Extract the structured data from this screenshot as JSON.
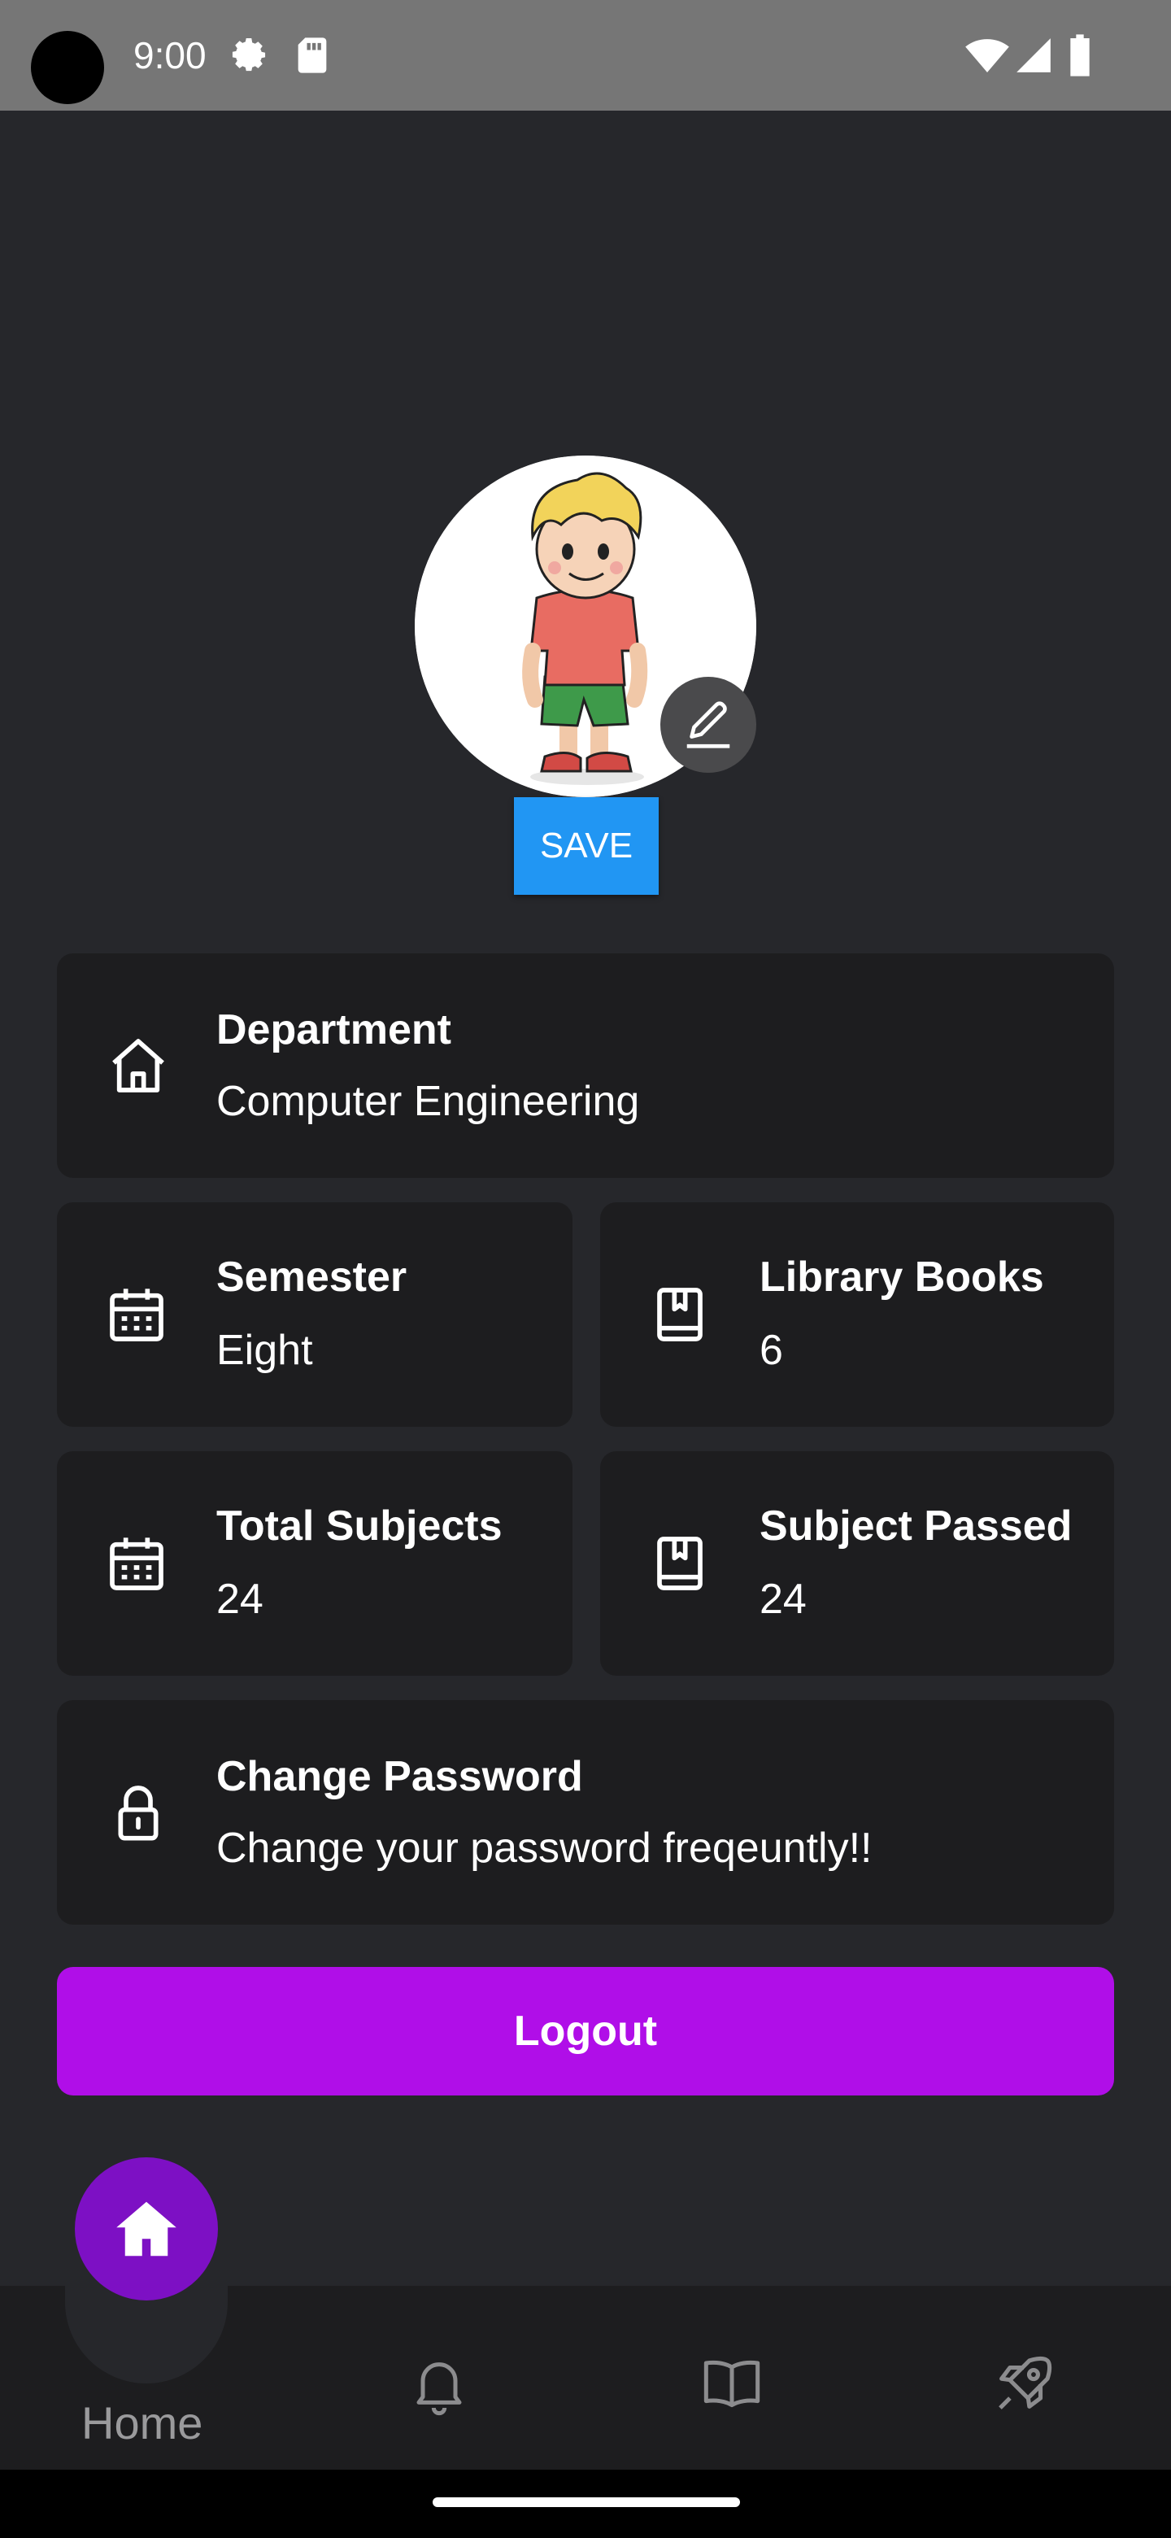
{
  "status_bar": {
    "time": "9:00",
    "icons": [
      "settings-gear-icon",
      "sd-card-icon",
      "wifi-icon",
      "signal-icon",
      "battery-icon"
    ]
  },
  "profile": {
    "avatar": "cartoon-boy-avatar",
    "edit_icon": "pencil-icon",
    "save_label": "SAVE"
  },
  "cards": {
    "department": {
      "title": "Department",
      "value": "Computer Engineering",
      "icon": "home-outline-icon"
    },
    "semester": {
      "title": "Semester",
      "value": "Eight",
      "icon": "calendar-icon"
    },
    "library_books": {
      "title": "Library Books",
      "value": "6",
      "icon": "book-icon"
    },
    "total_subjects": {
      "title": "Total Subjects",
      "value": "24",
      "icon": "calendar-icon"
    },
    "subject_passed": {
      "title": "Subject Passed",
      "value": "24",
      "icon": "book-icon"
    },
    "change_password": {
      "title": "Change Password",
      "value": "Change your password freqeuntly!!",
      "icon": "lock-icon"
    }
  },
  "logout_label": "Logout",
  "bottom_nav": {
    "active": "Home",
    "items": [
      {
        "label": "Home",
        "icon": "home-icon"
      },
      {
        "label": "",
        "icon": "bell-icon"
      },
      {
        "label": "",
        "icon": "open-book-icon"
      },
      {
        "label": "",
        "icon": "rocket-icon"
      }
    ]
  },
  "colors": {
    "background": "#26272b",
    "card": "#1d1d1f",
    "save_button": "#2196f3",
    "logout_button": "#b00ee8",
    "fab": "#7d10c4"
  }
}
